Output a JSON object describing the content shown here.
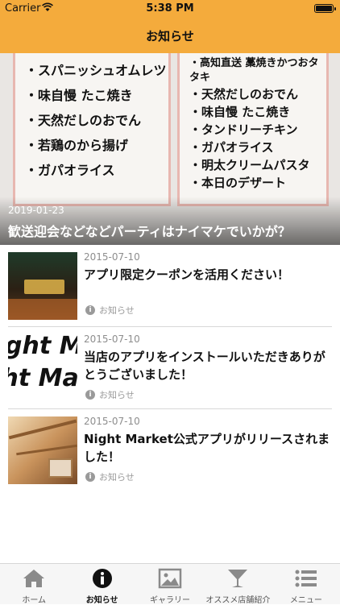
{
  "status_bar": {
    "carrier": "Carrier",
    "time": "5:38 PM"
  },
  "nav": {
    "title": "お知らせ"
  },
  "hero": {
    "menu_left": [
      "・スパニッシュオムレツ",
      "・味自慢 たこ焼き",
      "・天然だしのおでん",
      "・若鶏のから揚げ",
      "・ガパオライス"
    ],
    "menu_right": [
      "・高知直送 藁焼きかつおタタキ",
      "・天然だしのおでん",
      "・味自慢 たこ焼き",
      "・タンドリーチキン",
      "・ガパオライス",
      "・明太クリームパスタ",
      "・本日のデザート"
    ],
    "date": "2019-01-23",
    "title": "歓送迎会などなどパーティはナイマケでいかが？"
  },
  "news": [
    {
      "date": "2015-07-10",
      "title": "アプリ限定クーポンを活用ください！",
      "category": "お知らせ"
    },
    {
      "date": "2015-07-10",
      "title": "当店のアプリをインストールいただきありがとうございました！",
      "category": "お知らせ"
    },
    {
      "date": "2015-07-10",
      "title": "Night Market公式アプリがリリースされました！",
      "category": "お知らせ"
    }
  ],
  "thumb2_text": "ght Mar",
  "tabs": [
    {
      "label": "ホーム",
      "icon": "home-icon",
      "active": false
    },
    {
      "label": "お知らせ",
      "icon": "info-icon",
      "active": true
    },
    {
      "label": "ギャラリー",
      "icon": "gallery-icon",
      "active": false
    },
    {
      "label": "オススメ店舗紹介",
      "icon": "cocktail-icon",
      "active": false
    },
    {
      "label": "メニュー",
      "icon": "menu-list-icon",
      "active": false
    }
  ],
  "colors": {
    "accent": "#f4ab3c",
    "tab_inactive": "#8a8a8a",
    "tab_active": "#111111"
  }
}
